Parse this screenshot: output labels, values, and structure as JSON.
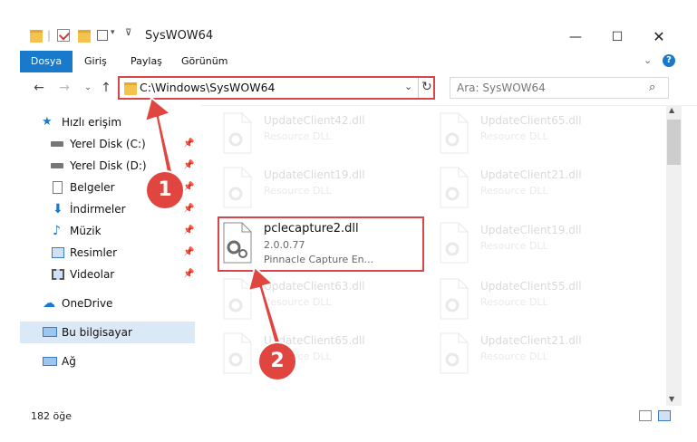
{
  "window": {
    "title": "SysWOW64"
  },
  "ribbon": {
    "tabs": [
      "Dosya",
      "Giriş",
      "Paylaş",
      "Görünüm"
    ]
  },
  "address": {
    "path": "C:\\Windows\\SysWOW64"
  },
  "search": {
    "placeholder": "Ara: SysWOW64"
  },
  "sidebar": {
    "quick_access": "Hızlı erişim",
    "items": [
      {
        "label": "Yerel Disk (C:)",
        "icon": "drive-icon"
      },
      {
        "label": "Yerel Disk (D:)",
        "icon": "drive-icon"
      },
      {
        "label": "Belgeler",
        "icon": "documents-icon"
      },
      {
        "label": "İndirmeler",
        "icon": "download-icon"
      },
      {
        "label": "Müzik",
        "icon": "music-icon"
      },
      {
        "label": "Resimler",
        "icon": "pictures-icon"
      },
      {
        "label": "Videolar",
        "icon": "videos-icon"
      }
    ],
    "onedrive": "OneDrive",
    "this_pc": "Bu bilgisayar",
    "network": "Ağ"
  },
  "files": {
    "left": [
      {
        "name": "UpdateClient42.dll",
        "type": "Resource DLL"
      },
      {
        "name": "UpdateClient19.dll",
        "type": "Resource DLL"
      },
      {
        "name": "pclecapture2.dll",
        "version": "2.0.0.77",
        "type": "Pinnacle Capture En..."
      },
      {
        "name": "UpdateClient63.dll",
        "type": "Resource DLL"
      },
      {
        "name": "UpdateClient65.dll",
        "type": "Resource DLL"
      }
    ],
    "right": [
      {
        "name": "UpdateClient65.dll",
        "type": "Resource DLL"
      },
      {
        "name": "UpdateClient21.dll",
        "type": "Resource DLL"
      },
      {
        "name": "UpdateClient19.dll",
        "type": "Resource DLL"
      },
      {
        "name": "UpdateClient55.dll",
        "type": "Resource DLL"
      },
      {
        "name": "UpdateClient21.dll",
        "type": "Resource DLL"
      }
    ]
  },
  "status": {
    "count": "182 öğe"
  },
  "annotations": {
    "badge1": "1",
    "badge2": "2"
  },
  "colors": {
    "accent": "#1979ca",
    "highlight": "#d9464a",
    "badge": "#e0463f"
  }
}
